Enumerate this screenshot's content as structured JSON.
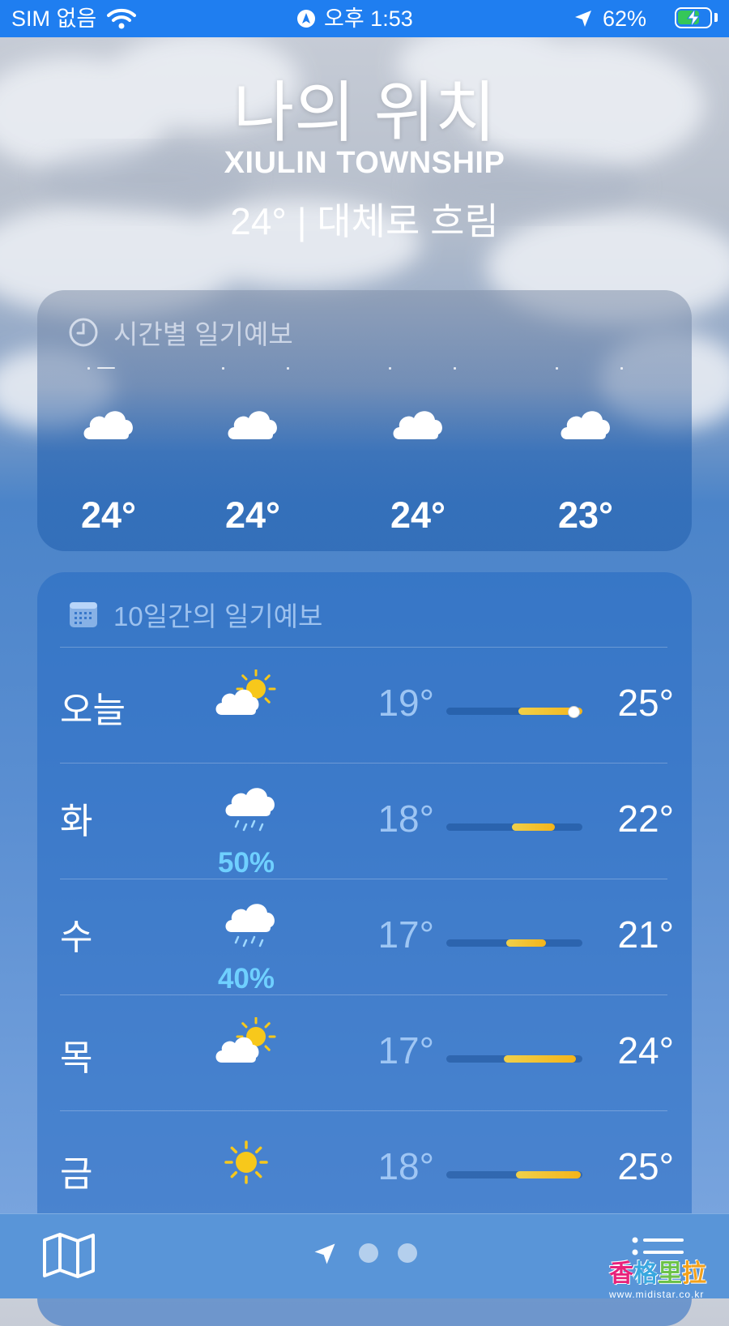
{
  "status_bar": {
    "carrier": "SIM 없음",
    "time": "오후 1:53",
    "battery": "62%"
  },
  "header": {
    "title": "나의 위치",
    "subtitle": "XIULIN TOWNSHIP",
    "current": "24°  |  대체로 흐림"
  },
  "hourly": {
    "title": "시간별 일기예보",
    "items": [
      {
        "temp": "24°",
        "icon": "cloud-icon"
      },
      {
        "temp": "24°",
        "icon": "cloud-icon"
      },
      {
        "temp": "24°",
        "icon": "cloud-icon"
      },
      {
        "temp": "23°",
        "icon": "cloud-icon"
      }
    ]
  },
  "daily": {
    "title": "10일간의 일기예보",
    "days": [
      {
        "day": "오늘",
        "icon": "partly-sunny-icon",
        "pop": "",
        "low": "19°",
        "high": "25°",
        "range": [
          0.53,
          1.0
        ],
        "current": 0.93
      },
      {
        "day": "화",
        "icon": "rain-cloud-icon",
        "pop": "50%",
        "low": "18°",
        "high": "22°",
        "range": [
          0.48,
          0.8
        ]
      },
      {
        "day": "수",
        "icon": "rain-cloud-icon",
        "pop": "40%",
        "low": "17°",
        "high": "21°",
        "range": [
          0.44,
          0.73
        ]
      },
      {
        "day": "목",
        "icon": "partly-sunny-icon",
        "pop": "",
        "low": "17°",
        "high": "24°",
        "range": [
          0.42,
          0.95
        ]
      },
      {
        "day": "금",
        "icon": "sun-icon",
        "pop": "",
        "low": "18°",
        "high": "25°",
        "range": [
          0.51,
          0.99
        ]
      }
    ]
  },
  "watermark": {
    "chars": [
      "香",
      "格",
      "里",
      "拉"
    ],
    "colors": [
      "#e8217a",
      "#3aa8e0",
      "#6cc24a",
      "#f4a21c"
    ],
    "url": "www.midistar.co.kr"
  },
  "colors": {
    "status_bar": "#1f7ef0",
    "battery_green": "#35c759",
    "sun": "#f7c81b",
    "pop_blue": "#6fd0ff"
  }
}
